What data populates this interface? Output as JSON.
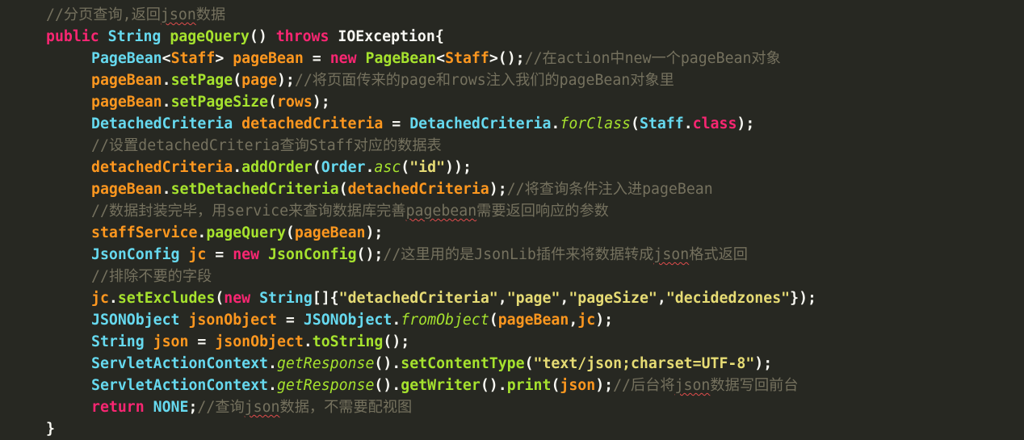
{
  "colors": {
    "background": "#272822",
    "comment": "#75715e",
    "keyword": "#f92672",
    "type": "#66d9ef",
    "method": "#a6e22e",
    "variable": "#fd971f",
    "plain": "#f8f8f2",
    "string": "#e6db74",
    "spell_error": "#e04c4c"
  },
  "code": {
    "lines": [
      [
        [
          "comment",
          "//分页查询,返回"
        ],
        [
          "comment squiggle",
          "json"
        ],
        [
          "comment",
          "数据"
        ]
      ],
      [
        [
          "kw",
          "public"
        ],
        [
          "plain",
          " "
        ],
        [
          "type",
          "String"
        ],
        [
          "plain",
          " "
        ],
        [
          "method",
          "pageQuery"
        ],
        [
          "plain",
          "() "
        ],
        [
          "kw",
          "throws"
        ],
        [
          "plain",
          " IOException{"
        ]
      ],
      [
        [
          "cls",
          "PageBean"
        ],
        [
          "plain",
          "<"
        ],
        [
          "var",
          "Staff"
        ],
        [
          "plain",
          "> "
        ],
        [
          "var",
          "pageBean"
        ],
        [
          "plain",
          " = "
        ],
        [
          "kw",
          "new"
        ],
        [
          "plain",
          " "
        ],
        [
          "method",
          "PageBean"
        ],
        [
          "plain",
          "<"
        ],
        [
          "var",
          "Staff"
        ],
        [
          "plain",
          ">();"
        ],
        [
          "comment",
          "//在action中new一个pageBean对象"
        ]
      ],
      [
        [
          "var",
          "pageBean"
        ],
        [
          "plain",
          "."
        ],
        [
          "method",
          "setPage"
        ],
        [
          "plain",
          "("
        ],
        [
          "var",
          "page"
        ],
        [
          "plain",
          ");"
        ],
        [
          "comment",
          "//将页面传来的page和rows注入我们的pageBean对象里"
        ]
      ],
      [
        [
          "var",
          "pageBean"
        ],
        [
          "plain",
          "."
        ],
        [
          "method",
          "setPageSize"
        ],
        [
          "plain",
          "("
        ],
        [
          "var",
          "rows"
        ],
        [
          "plain",
          ");"
        ]
      ],
      [
        [
          "cls",
          "DetachedCriteria"
        ],
        [
          "plain",
          " "
        ],
        [
          "var",
          "detachedCriteria"
        ],
        [
          "plain",
          " = "
        ],
        [
          "cls",
          "DetachedCriteria"
        ],
        [
          "plain",
          "."
        ],
        [
          "smethod",
          "forClass"
        ],
        [
          "plain",
          "("
        ],
        [
          "cls",
          "Staff"
        ],
        [
          "plain",
          "."
        ],
        [
          "kw",
          "class"
        ],
        [
          "plain",
          ");"
        ]
      ],
      [
        [
          "comment",
          "//设置detachedCriteria查询Staff对应的数据表"
        ]
      ],
      [
        [
          "var",
          "detachedCriteria"
        ],
        [
          "plain",
          "."
        ],
        [
          "method",
          "addOrder"
        ],
        [
          "plain",
          "("
        ],
        [
          "cls",
          "Order"
        ],
        [
          "plain",
          "."
        ],
        [
          "smethod",
          "asc"
        ],
        [
          "plain",
          "("
        ],
        [
          "str",
          "\"id\""
        ],
        [
          "plain",
          "));"
        ]
      ],
      [
        [
          "var",
          "pageBean"
        ],
        [
          "plain",
          "."
        ],
        [
          "method",
          "setDetachedCriteria"
        ],
        [
          "plain",
          "("
        ],
        [
          "var",
          "detachedCriteria"
        ],
        [
          "plain",
          ");"
        ],
        [
          "comment",
          "//将查询条件注入进pageBean"
        ]
      ],
      [
        [
          "comment",
          "//数据封装完毕，用service来查询数据库完善"
        ],
        [
          "comment squiggle",
          "pagebean"
        ],
        [
          "comment",
          "需要返回响应的参数"
        ]
      ],
      [
        [
          "var",
          "staffService"
        ],
        [
          "plain",
          "."
        ],
        [
          "method",
          "pageQuery"
        ],
        [
          "plain",
          "("
        ],
        [
          "var",
          "pageBean"
        ],
        [
          "plain",
          ");"
        ]
      ],
      [
        [
          "cls",
          "JsonConfig"
        ],
        [
          "plain",
          " "
        ],
        [
          "var",
          "jc"
        ],
        [
          "plain",
          " = "
        ],
        [
          "kw",
          "new"
        ],
        [
          "plain",
          " "
        ],
        [
          "method",
          "JsonConfig"
        ],
        [
          "plain",
          "();"
        ],
        [
          "comment",
          "//这里用的是JsonLib插件来将数据转成"
        ],
        [
          "comment squiggle",
          "json"
        ],
        [
          "comment",
          "格式返回"
        ]
      ],
      [
        [
          "comment",
          "//排除不要的字段"
        ]
      ],
      [
        [
          "var",
          "jc"
        ],
        [
          "plain",
          "."
        ],
        [
          "method",
          "setExcludes"
        ],
        [
          "plain",
          "("
        ],
        [
          "kw",
          "new"
        ],
        [
          "plain",
          " "
        ],
        [
          "type",
          "String"
        ],
        [
          "plain",
          "[]{"
        ],
        [
          "str",
          "\"detachedCriteria\""
        ],
        [
          "plain",
          ","
        ],
        [
          "str",
          "\"page\""
        ],
        [
          "plain",
          ","
        ],
        [
          "str",
          "\"pageSize\""
        ],
        [
          "plain",
          ","
        ],
        [
          "str",
          "\"decidedzones\""
        ],
        [
          "plain",
          "});"
        ]
      ],
      [
        [
          "cls",
          "JSONObject"
        ],
        [
          "plain",
          " "
        ],
        [
          "var",
          "jsonObject"
        ],
        [
          "plain",
          " = "
        ],
        [
          "cls",
          "JSONObject"
        ],
        [
          "plain",
          "."
        ],
        [
          "smethod",
          "fromObject"
        ],
        [
          "plain",
          "("
        ],
        [
          "var",
          "pageBean"
        ],
        [
          "plain",
          ","
        ],
        [
          "var",
          "jc"
        ],
        [
          "plain",
          ");"
        ]
      ],
      [
        [
          "type",
          "String"
        ],
        [
          "plain",
          " "
        ],
        [
          "var",
          "json"
        ],
        [
          "plain",
          " = "
        ],
        [
          "var",
          "jsonObject"
        ],
        [
          "plain",
          "."
        ],
        [
          "method",
          "toString"
        ],
        [
          "plain",
          "();"
        ]
      ],
      [
        [
          "cls",
          "ServletActionContext"
        ],
        [
          "plain",
          "."
        ],
        [
          "smethod",
          "getResponse"
        ],
        [
          "plain",
          "()."
        ],
        [
          "method",
          "setContentType"
        ],
        [
          "plain",
          "("
        ],
        [
          "str",
          "\"text/json;charset=UTF-8\""
        ],
        [
          "plain",
          ");"
        ]
      ],
      [
        [
          "cls",
          "ServletActionContext"
        ],
        [
          "plain",
          "."
        ],
        [
          "smethod",
          "getResponse"
        ],
        [
          "plain",
          "()."
        ],
        [
          "method",
          "getWriter"
        ],
        [
          "plain",
          "()."
        ],
        [
          "method",
          "print"
        ],
        [
          "plain",
          "("
        ],
        [
          "var",
          "json"
        ],
        [
          "plain",
          ");"
        ],
        [
          "comment",
          "//后台将"
        ],
        [
          "comment squiggle",
          "json"
        ],
        [
          "comment",
          "数据写回前台"
        ]
      ],
      [
        [
          "kw",
          "return"
        ],
        [
          "plain",
          " "
        ],
        [
          "type",
          "NONE"
        ],
        [
          "plain",
          ";"
        ],
        [
          "comment",
          "//查询"
        ],
        [
          "comment squiggle",
          "json"
        ],
        [
          "comment",
          "数据，不需要配视图"
        ]
      ],
      [
        [
          "plain",
          "}"
        ]
      ]
    ]
  }
}
